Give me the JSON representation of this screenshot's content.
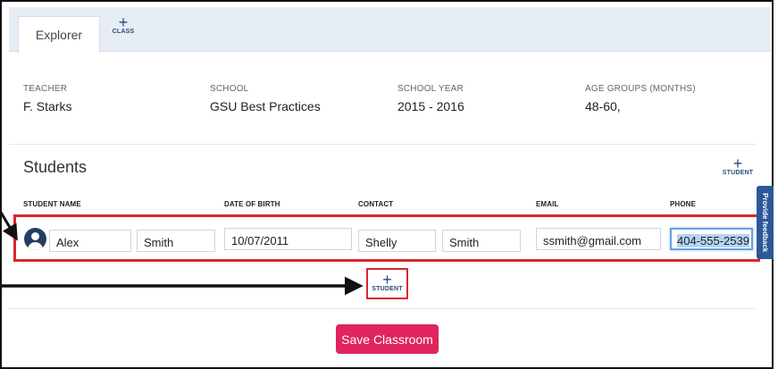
{
  "tabs": {
    "explorer_label": "Explorer",
    "add_class_plus": "+",
    "add_class_label": "CLASS"
  },
  "classroom": {
    "teacher_label": "TEACHER",
    "teacher_value": "F. Starks",
    "school_label": "SCHOOL",
    "school_value": "GSU Best Practices",
    "year_label": "SCHOOL YEAR",
    "year_value": "2015 - 2016",
    "age_label": "AGE GROUPS (MONTHS)",
    "age_value": "48-60,"
  },
  "students": {
    "title": "Students",
    "add_plus": "+",
    "add_label": "STUDENT",
    "columns": {
      "name": "STUDENT NAME",
      "dob": "DATE OF BIRTH",
      "contact": "CONTACT",
      "email": "EMAIL",
      "phone": "PHONE"
    },
    "row": {
      "first_name": "Alex",
      "last_name": "Smith",
      "dob": "10/07/2011",
      "contact_first": "Shelly",
      "contact_last": "Smith",
      "email": "ssmith@gmail.com",
      "phone": "404-555-2539"
    }
  },
  "feedback_label": "Provide feedback",
  "save_label": "Save Classroom",
  "colors": {
    "accent_red": "#d6282e",
    "save_button": "#e0245e",
    "navy": "#253d66",
    "tab_bar": "#e7edf5"
  }
}
